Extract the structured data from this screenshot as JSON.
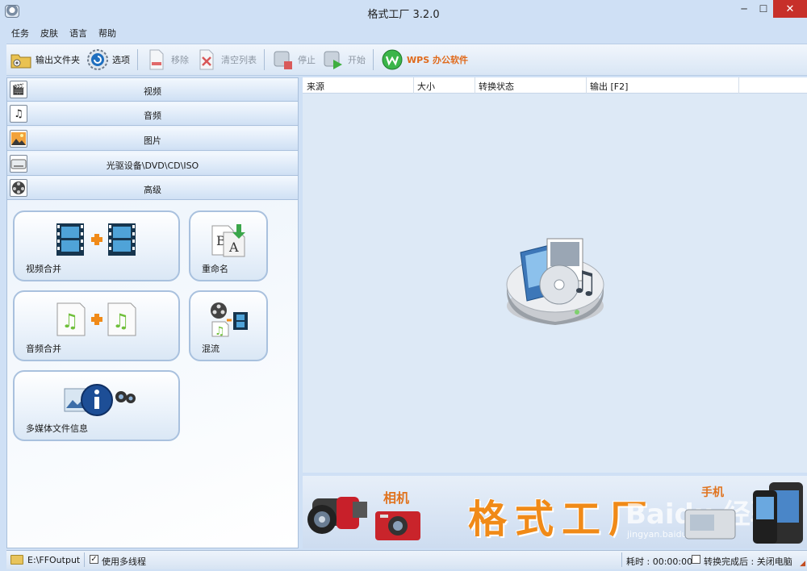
{
  "window": {
    "title": "格式工厂 3.2.0",
    "min": "─",
    "max": "☐",
    "close": "✕"
  },
  "menu": [
    "任务",
    "皮肤",
    "语言",
    "帮助"
  ],
  "toolbar": {
    "output_folder": "输出文件夹",
    "options": "选项",
    "remove": "移除",
    "clear_list": "清空列表",
    "stop": "停止",
    "start": "开始",
    "wps": "WPS 办公软件"
  },
  "categories": [
    "视频",
    "音频",
    "图片",
    "光驱设备\\DVD\\CD\\ISO",
    "高级"
  ],
  "tools": {
    "video_merge": "视频合并",
    "rename": "重命名",
    "audio_merge": "音频合并",
    "mux": "混流",
    "media_info": "多媒体文件信息"
  },
  "table": {
    "columns": [
      "来源",
      "大小",
      "转换状态",
      "输出 [F2]"
    ]
  },
  "banner": {
    "camera": "相机",
    "phone": "手机",
    "title": "格式工厂",
    "watermark": "Baidu 经验",
    "watermark_url": "jingyan.baidu.com"
  },
  "status": {
    "output_path": "E:\\FFOutput",
    "multithread": "使用多线程",
    "elapsed": "耗时 : 00:00:00",
    "after_done": "转换完成后 : 关闭电脑"
  },
  "colors": {
    "accent": "#f08a18",
    "close": "#c7302a",
    "panel": "#dde9f6"
  }
}
